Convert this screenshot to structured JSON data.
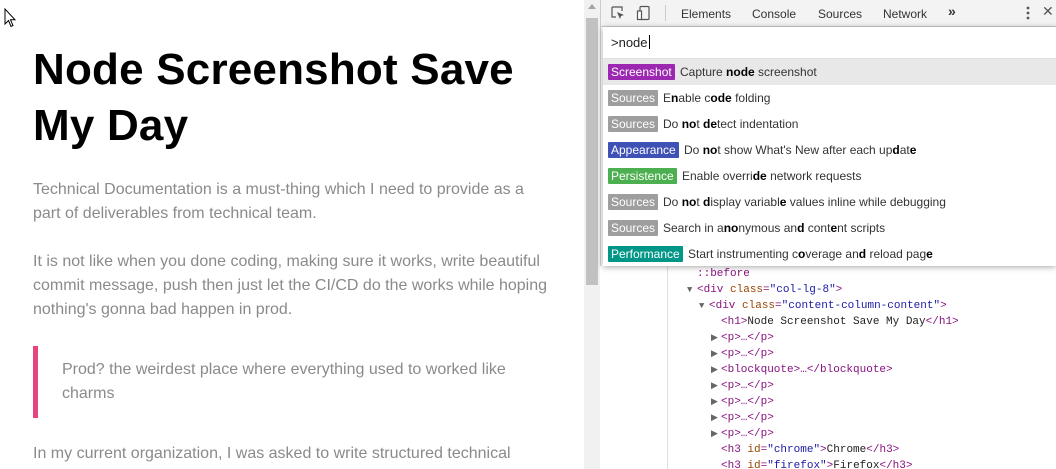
{
  "page": {
    "title": "Node Screenshot Save My Day",
    "paragraphs": [
      "Technical Documentation is a must-thing which I need to provide as a part of deliverables from technical team.",
      "It is not like when you done coding, making sure it works, write beautiful commit message, push then just let the CI/CD do the works while hoping nothing's gonna bad happen in prod.",
      "In my current organization, I was asked to write structured technical"
    ],
    "quote": "Prod? the weirdest place where everything used to worked like charms"
  },
  "devtools": {
    "tabs": [
      "Elements",
      "Console",
      "Sources",
      "Network"
    ],
    "more_tabs": "»",
    "command_input": ">node",
    "commands": [
      {
        "category": "Screenshot",
        "color": "#9c27b0",
        "title_html": "Capture <b>node</b> screenshot",
        "selected": true
      },
      {
        "category": "Sources",
        "color": "#9e9e9e",
        "title_html": "E<b>n</b>able c<b>ode</b> folding",
        "selected": false
      },
      {
        "category": "Sources",
        "color": "#9e9e9e",
        "title_html": "Do <b>no</b>t <b>de</b>tect indentation",
        "selected": false
      },
      {
        "category": "Appearance",
        "color": "#3f51b5",
        "title_html": "Do <b>no</b>t show What's New after each up<b>d</b>at<b>e</b>",
        "selected": false
      },
      {
        "category": "Persistence",
        "color": "#4caf50",
        "title_html": "Enable overri<b>de</b> network requests",
        "selected": false
      },
      {
        "category": "Sources",
        "color": "#9e9e9e",
        "title_html": "Do <b>no</b>t <b>d</b>isplay variabl<b>e</b> values inline while debugging",
        "selected": false
      },
      {
        "category": "Sources",
        "color": "#9e9e9e",
        "title_html": "Search in a<b>no</b>nymous an<b>d</b> cont<b>e</b>nt scripts",
        "selected": false
      },
      {
        "category": "Performance",
        "color": "#009688",
        "title_html": "Start instrumenting c<b>o</b>verage an<b>d</b> reload pag<b>e</b>",
        "selected": false
      }
    ],
    "tree": {
      "before": "::before",
      "div1_tag": "div",
      "div1_attr": "class",
      "div1_val": "\"col-lg-8\"",
      "div2_tag": "div",
      "div2_attr": "class",
      "div2_val": "\"content-column-content\"",
      "h1_open": "<h1>",
      "h1_text": "Node Screenshot Save My Day",
      "h1_close": "</h1>",
      "p_collapsed": "<p>…</p>",
      "blockquote_collapsed": "<blockquote>…</blockquote>",
      "h3_tag": "h3",
      "h3_attr": "id",
      "h3a_val": "\"chrome\"",
      "h3a_text": "Chrome",
      "h3b_val": "\"firefox\"",
      "h3b_text": "Firefox",
      "h3_close": "</h3>"
    }
  }
}
